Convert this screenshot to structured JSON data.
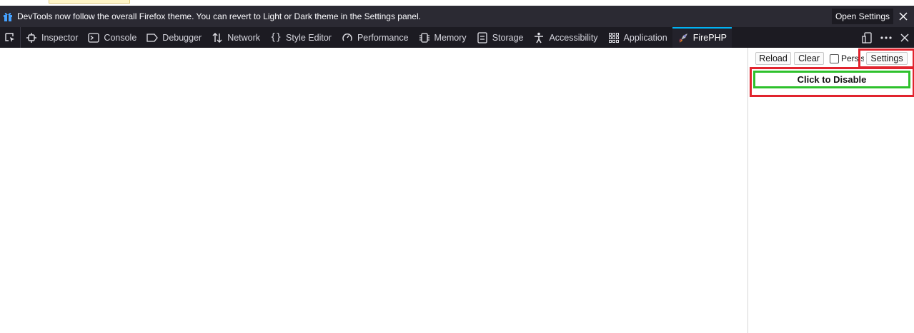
{
  "notification": {
    "message": "DevTools now follow the overall Firefox theme. You can revert to Light or Dark theme in the Settings panel.",
    "action_label": "Open Settings"
  },
  "toolbar": {
    "tabs": [
      {
        "label": "Inspector",
        "icon": "inspector-icon",
        "active": false
      },
      {
        "label": "Console",
        "icon": "console-icon",
        "active": false
      },
      {
        "label": "Debugger",
        "icon": "debugger-icon",
        "active": false
      },
      {
        "label": "Network",
        "icon": "network-icon",
        "active": false
      },
      {
        "label": "Style Editor",
        "icon": "style-editor-icon",
        "active": false
      },
      {
        "label": "Performance",
        "icon": "performance-icon",
        "active": false
      },
      {
        "label": "Memory",
        "icon": "memory-icon",
        "active": false
      },
      {
        "label": "Storage",
        "icon": "storage-icon",
        "active": false
      },
      {
        "label": "Accessibility",
        "icon": "accessibility-icon",
        "active": false
      },
      {
        "label": "Application",
        "icon": "application-icon",
        "active": false
      },
      {
        "label": "FirePHP",
        "icon": "firephp-icon",
        "active": true
      }
    ]
  },
  "firephp": {
    "reload_label": "Reload",
    "clear_label": "Clear",
    "persist_label": "Persist",
    "persist_checked": false,
    "settings_label": "Settings",
    "disable_label": "Click to Disable"
  },
  "colors": {
    "notification_bg": "#2b2a33",
    "toolbar_bg": "#1c1b22",
    "active_tab_indicator": "#00b3f4",
    "highlight_red": "#e1232d",
    "enabled_green": "#2ec12c"
  }
}
